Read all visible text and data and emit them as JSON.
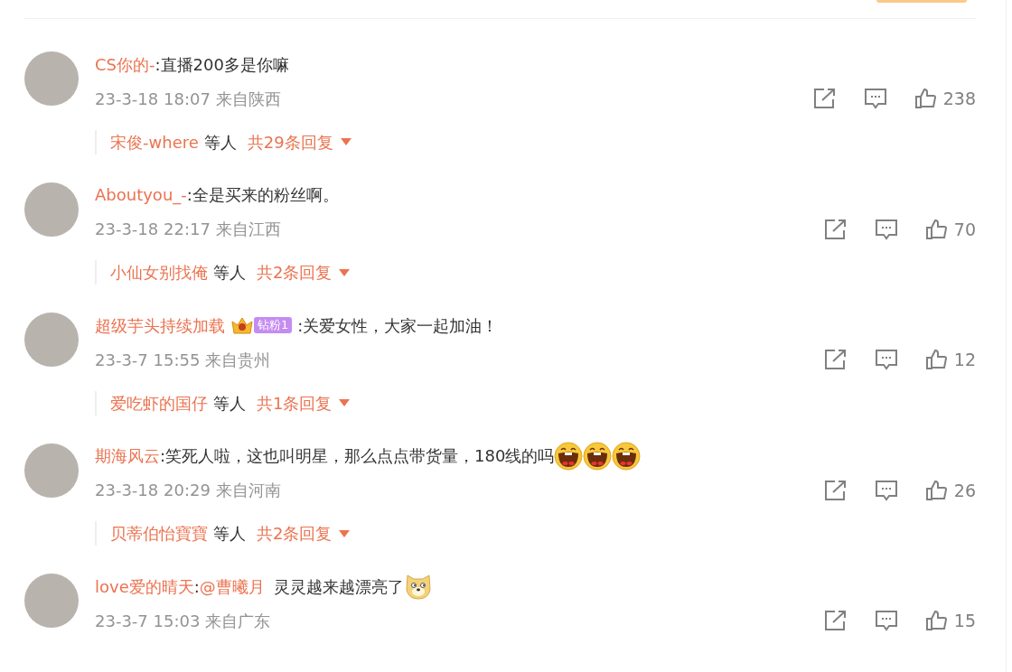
{
  "comments": [
    {
      "author": "CS你的-",
      "separator": ":",
      "text": "直播200多是你嘛",
      "time": "23-3-18 18:07",
      "location": "来自陕西",
      "likes": "238",
      "replies": {
        "first_name": "宋俊-where",
        "others": "等人",
        "count": "共29条回复"
      }
    },
    {
      "author": "Aboutyou_-",
      "separator": ":",
      "text": "全是买来的粉丝啊。",
      "time": "23-3-18 22:17",
      "location": "来自江西",
      "likes": "70",
      "replies": {
        "first_name": "小仙女别找俺",
        "others": "等人",
        "count": "共2条回复"
      }
    },
    {
      "author": "超级芋头持续加载",
      "separator": ":",
      "text": "关爱女性，大家一起加油！",
      "badge": "钻粉1",
      "time": "23-3-7 15:55",
      "location": "来自贵州",
      "likes": "12",
      "replies": {
        "first_name": "爱吃虾的国仔",
        "others": "等人",
        "count": "共1条回复"
      }
    },
    {
      "author": "期海风云",
      "separator": ":",
      "text": "笑死人啦，这也叫明星，那么点点带货量，180线的吗",
      "emojis": [
        {
          "kind": "laugh"
        },
        {
          "kind": "laugh"
        },
        {
          "kind": "laugh"
        }
      ],
      "time": "23-3-18 20:29",
      "location": "来自河南",
      "likes": "26",
      "replies": {
        "first_name": "贝蒂伯怡寶寶",
        "others": "等人",
        "count": "共2条回复"
      }
    },
    {
      "author": "love爱的晴天",
      "separator": ":",
      "mention": "@曹曦月",
      "text": "灵灵越来越漂亮了",
      "emojis": [
        {
          "kind": "doge"
        }
      ],
      "time": "23-3-7 15:03",
      "location": "来自广东",
      "likes": "15"
    }
  ]
}
